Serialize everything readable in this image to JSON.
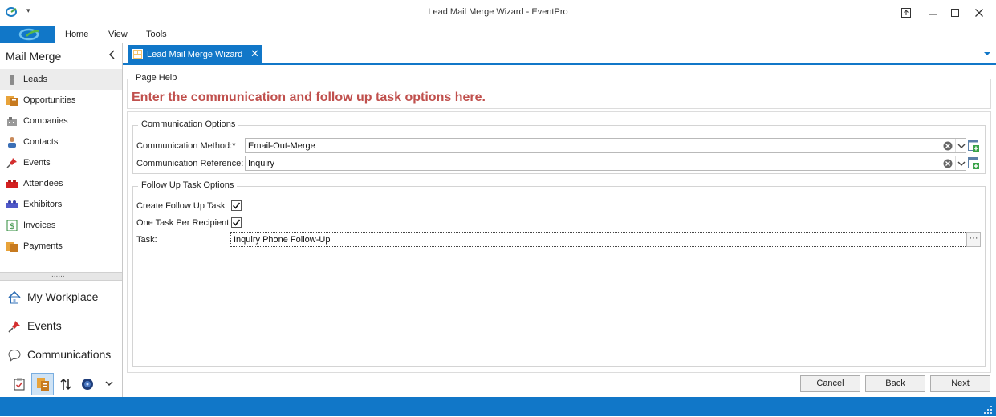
{
  "window": {
    "title": "Lead Mail Merge Wizard - EventPro"
  },
  "ribbon": {
    "tabs": [
      "Home",
      "View",
      "Tools"
    ]
  },
  "sidebar": {
    "header": "Mail Merge",
    "items": [
      {
        "label": "Leads",
        "icon": "person-icon",
        "selected": true
      },
      {
        "label": "Opportunities",
        "icon": "opportunities-icon"
      },
      {
        "label": "Companies",
        "icon": "company-icon"
      },
      {
        "label": "Contacts",
        "icon": "contact-icon"
      },
      {
        "label": "Events",
        "icon": "pushpin-icon"
      },
      {
        "label": "Attendees",
        "icon": "attendees-icon"
      },
      {
        "label": "Exhibitors",
        "icon": "exhibitors-icon"
      },
      {
        "label": "Invoices",
        "icon": "invoice-icon"
      },
      {
        "label": "Payments",
        "icon": "payments-icon"
      }
    ],
    "splitter": "......",
    "big_items": [
      {
        "label": "My Workplace",
        "icon": "house-icon"
      },
      {
        "label": "Events",
        "icon": "pushpin-icon"
      },
      {
        "label": "Communications",
        "icon": "speech-bubble-icon"
      }
    ]
  },
  "document_tab": {
    "label": "Lead Mail Merge Wizard",
    "close": "✕"
  },
  "page_help": {
    "group_title": "Page Help",
    "text": "Enter the communication and follow up task options here.",
    "color": "#c0504d"
  },
  "communication_options": {
    "group_title": "Communication Options",
    "method_label": "Communication Method:*",
    "method_value": "Email-Out-Merge",
    "reference_label": "Communication Reference:",
    "reference_value": "Inquiry"
  },
  "follow_up": {
    "group_title": "Follow Up Task Options",
    "create_label": "Create Follow Up Task",
    "create_checked": true,
    "one_task_label": "One Task Per Recipient",
    "one_task_checked": true,
    "task_label": "Task:",
    "task_value": "Inquiry Phone Follow-Up",
    "ellipsis": "···"
  },
  "buttons": {
    "cancel": "Cancel",
    "back": "Back",
    "next": "Next"
  },
  "colors": {
    "accent": "#1177c8"
  }
}
